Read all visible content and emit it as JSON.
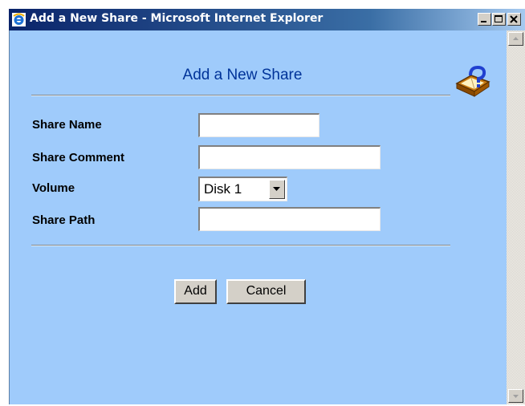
{
  "window": {
    "title": "Add a New Share - Microsoft Internet Explorer",
    "app_icon": "internet-explorer-icon",
    "controls": [
      "minimize-icon",
      "maximize-icon",
      "close-icon"
    ]
  },
  "page": {
    "heading": "Add a New Share",
    "help_icon": "help-book-icon"
  },
  "form": {
    "share_name": {
      "label": "Share Name",
      "value": ""
    },
    "share_comment": {
      "label": "Share Comment",
      "value": ""
    },
    "volume": {
      "label": "Volume",
      "selected": "Disk 1"
    },
    "share_path": {
      "label": "Share Path",
      "value": ""
    }
  },
  "buttons": {
    "add": "Add",
    "cancel": "Cancel"
  },
  "colors": {
    "background": "#9fcbfb",
    "heading": "#003399",
    "titlebar_start": "#0a246a",
    "titlebar_end": "#a6caf0"
  }
}
